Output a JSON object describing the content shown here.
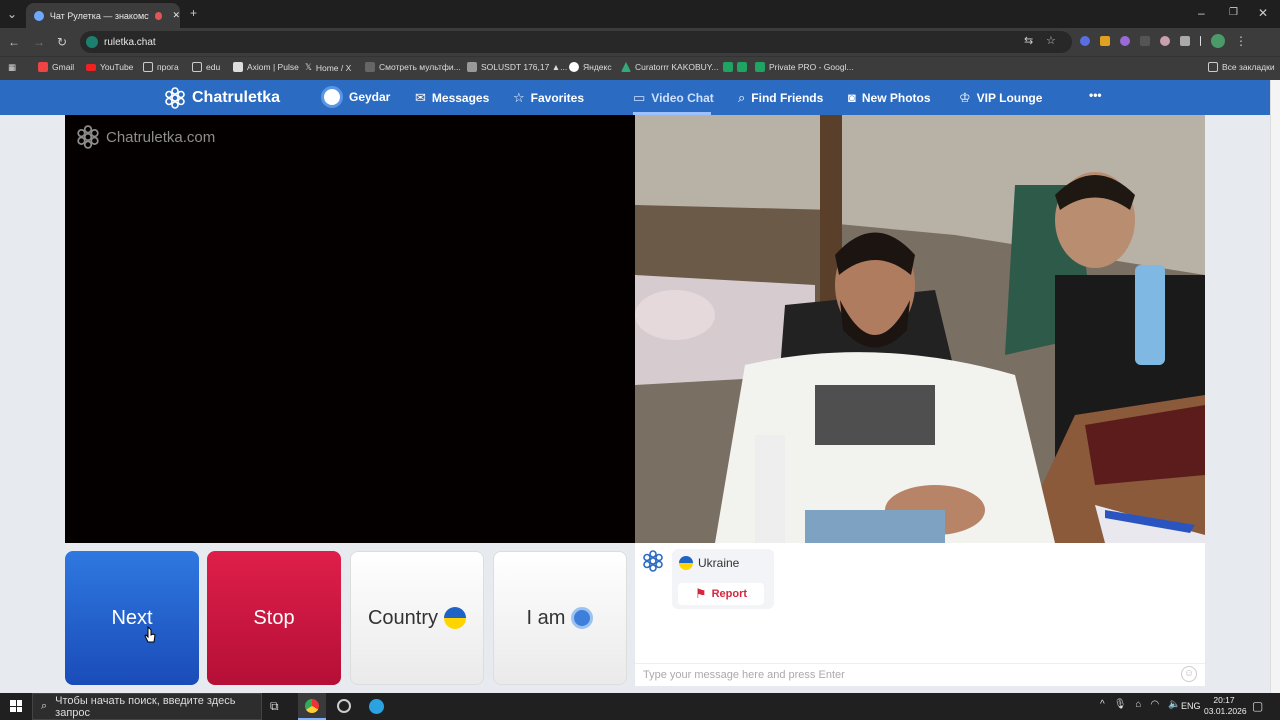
{
  "browser": {
    "tab_title": "Чат Рулетка — знакомств…",
    "url": "ruletka.chat",
    "bookmarks": [
      "Gmail",
      "YouTube",
      "прога",
      "edu",
      "Axiom | Pulse",
      "Home / X",
      "Смотреть мультфи...",
      "SOLUSDT 176,17 ▲...",
      "Яндекс",
      "Curatorrr KAKOBUY...",
      "Private PRO - Googl..."
    ],
    "all_bookmarks": "Все закладки"
  },
  "site": {
    "logo": "Chatruletka",
    "user": "Geydar",
    "nav": [
      "Messages",
      "Favorites",
      "Video Chat",
      "Find Friends",
      "New Photos",
      "VIP Lounge"
    ],
    "more": "•••",
    "watermark": "Chatruletka.com"
  },
  "controls": {
    "next": "Next",
    "stop": "Stop",
    "country": "Country",
    "iam": "I am"
  },
  "chat": {
    "country": "Ukraine",
    "report": "Report",
    "placeholder": "Type your message here and press Enter"
  },
  "taskbar": {
    "search_placeholder": "Чтобы начать поиск, введите здесь запрос",
    "lang": "ENG",
    "time": "20:17",
    "date": "03.01.2026"
  },
  "colors": {
    "nav_blue": "#2b6cc2",
    "next_blue": "#2057c7",
    "stop_red": "#c8123f",
    "report_red": "#d7263d",
    "ukraine_blue": "#1f63c6",
    "ukraine_yellow": "#ffd500"
  }
}
